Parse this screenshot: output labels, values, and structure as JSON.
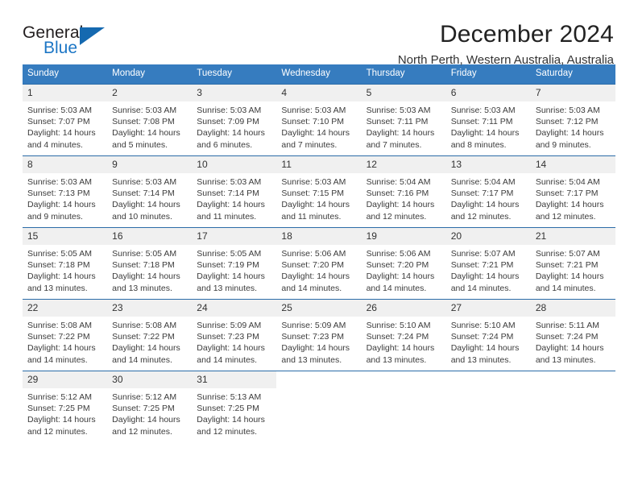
{
  "brand": {
    "name_part1": "General",
    "name_part2": "Blue",
    "mark": "triangle-logo",
    "accent_color": "#1569b0"
  },
  "header": {
    "title": "December 2024",
    "subtitle": "North Perth, Western Australia, Australia"
  },
  "calendar": {
    "header_bg": "#367cbf",
    "weekdays": [
      "Sunday",
      "Monday",
      "Tuesday",
      "Wednesday",
      "Thursday",
      "Friday",
      "Saturday"
    ],
    "weeks": [
      [
        {
          "day": "1",
          "sunrise": "Sunrise: 5:03 AM",
          "sunset": "Sunset: 7:07 PM",
          "daylight": "Daylight: 14 hours and 4 minutes."
        },
        {
          "day": "2",
          "sunrise": "Sunrise: 5:03 AM",
          "sunset": "Sunset: 7:08 PM",
          "daylight": "Daylight: 14 hours and 5 minutes."
        },
        {
          "day": "3",
          "sunrise": "Sunrise: 5:03 AM",
          "sunset": "Sunset: 7:09 PM",
          "daylight": "Daylight: 14 hours and 6 minutes."
        },
        {
          "day": "4",
          "sunrise": "Sunrise: 5:03 AM",
          "sunset": "Sunset: 7:10 PM",
          "daylight": "Daylight: 14 hours and 7 minutes."
        },
        {
          "day": "5",
          "sunrise": "Sunrise: 5:03 AM",
          "sunset": "Sunset: 7:11 PM",
          "daylight": "Daylight: 14 hours and 7 minutes."
        },
        {
          "day": "6",
          "sunrise": "Sunrise: 5:03 AM",
          "sunset": "Sunset: 7:11 PM",
          "daylight": "Daylight: 14 hours and 8 minutes."
        },
        {
          "day": "7",
          "sunrise": "Sunrise: 5:03 AM",
          "sunset": "Sunset: 7:12 PM",
          "daylight": "Daylight: 14 hours and 9 minutes."
        }
      ],
      [
        {
          "day": "8",
          "sunrise": "Sunrise: 5:03 AM",
          "sunset": "Sunset: 7:13 PM",
          "daylight": "Daylight: 14 hours and 9 minutes."
        },
        {
          "day": "9",
          "sunrise": "Sunrise: 5:03 AM",
          "sunset": "Sunset: 7:14 PM",
          "daylight": "Daylight: 14 hours and 10 minutes."
        },
        {
          "day": "10",
          "sunrise": "Sunrise: 5:03 AM",
          "sunset": "Sunset: 7:14 PM",
          "daylight": "Daylight: 14 hours and 11 minutes."
        },
        {
          "day": "11",
          "sunrise": "Sunrise: 5:03 AM",
          "sunset": "Sunset: 7:15 PM",
          "daylight": "Daylight: 14 hours and 11 minutes."
        },
        {
          "day": "12",
          "sunrise": "Sunrise: 5:04 AM",
          "sunset": "Sunset: 7:16 PM",
          "daylight": "Daylight: 14 hours and 12 minutes."
        },
        {
          "day": "13",
          "sunrise": "Sunrise: 5:04 AM",
          "sunset": "Sunset: 7:17 PM",
          "daylight": "Daylight: 14 hours and 12 minutes."
        },
        {
          "day": "14",
          "sunrise": "Sunrise: 5:04 AM",
          "sunset": "Sunset: 7:17 PM",
          "daylight": "Daylight: 14 hours and 12 minutes."
        }
      ],
      [
        {
          "day": "15",
          "sunrise": "Sunrise: 5:05 AM",
          "sunset": "Sunset: 7:18 PM",
          "daylight": "Daylight: 14 hours and 13 minutes."
        },
        {
          "day": "16",
          "sunrise": "Sunrise: 5:05 AM",
          "sunset": "Sunset: 7:18 PM",
          "daylight": "Daylight: 14 hours and 13 minutes."
        },
        {
          "day": "17",
          "sunrise": "Sunrise: 5:05 AM",
          "sunset": "Sunset: 7:19 PM",
          "daylight": "Daylight: 14 hours and 13 minutes."
        },
        {
          "day": "18",
          "sunrise": "Sunrise: 5:06 AM",
          "sunset": "Sunset: 7:20 PM",
          "daylight": "Daylight: 14 hours and 14 minutes."
        },
        {
          "day": "19",
          "sunrise": "Sunrise: 5:06 AM",
          "sunset": "Sunset: 7:20 PM",
          "daylight": "Daylight: 14 hours and 14 minutes."
        },
        {
          "day": "20",
          "sunrise": "Sunrise: 5:07 AM",
          "sunset": "Sunset: 7:21 PM",
          "daylight": "Daylight: 14 hours and 14 minutes."
        },
        {
          "day": "21",
          "sunrise": "Sunrise: 5:07 AM",
          "sunset": "Sunset: 7:21 PM",
          "daylight": "Daylight: 14 hours and 14 minutes."
        }
      ],
      [
        {
          "day": "22",
          "sunrise": "Sunrise: 5:08 AM",
          "sunset": "Sunset: 7:22 PM",
          "daylight": "Daylight: 14 hours and 14 minutes."
        },
        {
          "day": "23",
          "sunrise": "Sunrise: 5:08 AM",
          "sunset": "Sunset: 7:22 PM",
          "daylight": "Daylight: 14 hours and 14 minutes."
        },
        {
          "day": "24",
          "sunrise": "Sunrise: 5:09 AM",
          "sunset": "Sunset: 7:23 PM",
          "daylight": "Daylight: 14 hours and 14 minutes."
        },
        {
          "day": "25",
          "sunrise": "Sunrise: 5:09 AM",
          "sunset": "Sunset: 7:23 PM",
          "daylight": "Daylight: 14 hours and 13 minutes."
        },
        {
          "day": "26",
          "sunrise": "Sunrise: 5:10 AM",
          "sunset": "Sunset: 7:24 PM",
          "daylight": "Daylight: 14 hours and 13 minutes."
        },
        {
          "day": "27",
          "sunrise": "Sunrise: 5:10 AM",
          "sunset": "Sunset: 7:24 PM",
          "daylight": "Daylight: 14 hours and 13 minutes."
        },
        {
          "day": "28",
          "sunrise": "Sunrise: 5:11 AM",
          "sunset": "Sunset: 7:24 PM",
          "daylight": "Daylight: 14 hours and 13 minutes."
        }
      ],
      [
        {
          "day": "29",
          "sunrise": "Sunrise: 5:12 AM",
          "sunset": "Sunset: 7:25 PM",
          "daylight": "Daylight: 14 hours and 12 minutes."
        },
        {
          "day": "30",
          "sunrise": "Sunrise: 5:12 AM",
          "sunset": "Sunset: 7:25 PM",
          "daylight": "Daylight: 14 hours and 12 minutes."
        },
        {
          "day": "31",
          "sunrise": "Sunrise: 5:13 AM",
          "sunset": "Sunset: 7:25 PM",
          "daylight": "Daylight: 14 hours and 12 minutes."
        },
        {
          "day": "",
          "sunrise": "",
          "sunset": "",
          "daylight": ""
        },
        {
          "day": "",
          "sunrise": "",
          "sunset": "",
          "daylight": ""
        },
        {
          "day": "",
          "sunrise": "",
          "sunset": "",
          "daylight": ""
        },
        {
          "day": "",
          "sunrise": "",
          "sunset": "",
          "daylight": ""
        }
      ]
    ]
  }
}
